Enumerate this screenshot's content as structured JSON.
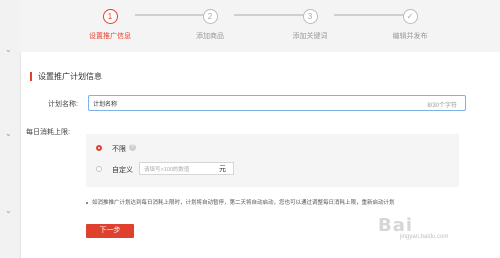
{
  "stepper": {
    "steps": [
      {
        "num": "1",
        "label": "设置推广信息"
      },
      {
        "num": "2",
        "label": "添加商品"
      },
      {
        "num": "3",
        "label": "添加关键词"
      },
      {
        "num": "✓",
        "label": "编辑并发布"
      }
    ],
    "active_step": 1
  },
  "section": {
    "title": "设置推广计划信息"
  },
  "plan_name": {
    "label": "计划名称:",
    "value": "计划名称",
    "counter": "8/30个字符"
  },
  "budget": {
    "label": "每日消耗上限:",
    "option_unlimited": "不限",
    "option_custom": "自定义",
    "amount_placeholder": "请填写>100的数值",
    "unit": "元",
    "selected": "不限"
  },
  "note": "如消推推广计划达到每日消耗上限时，计划将自动暂停，第二天将自动启动，您也可以通过调整每日消耗上限，重新启动计划",
  "next_button": "下一步",
  "watermark": {
    "logo": "Bai",
    "url": "jingyan.baidu.com"
  },
  "colors": {
    "accent": "#e0412f",
    "input_focus": "#7fb3e6",
    "panel": "#f5f5f5"
  }
}
